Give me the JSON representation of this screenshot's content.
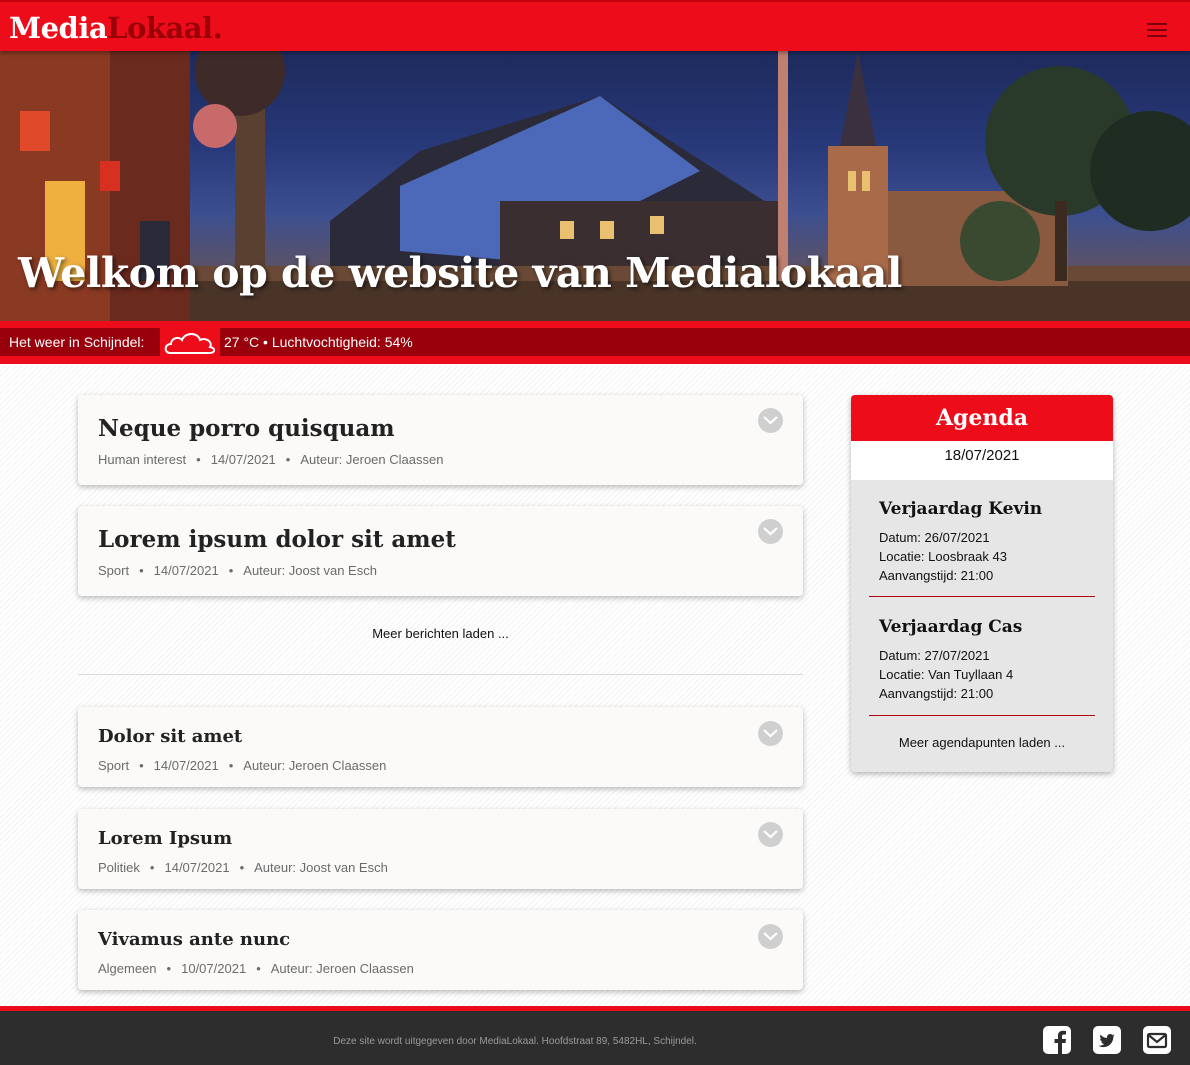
{
  "header": {
    "logo_part1": "Media",
    "logo_part2": "Lokaal.",
    "menu_icon": "hamburger-menu-icon"
  },
  "hero": {
    "title": "Welkom op de website van Medialokaal"
  },
  "weather": {
    "label": "Het weer in Schijndel:",
    "icon": "cloud-icon",
    "info": "27 °C • Luchtvochtigheid: 54%"
  },
  "articles": [
    {
      "title": "Neque porro quisquam",
      "category": "Human interest",
      "date": "14/07/2021",
      "author": "Auteur: Jeroen Claassen"
    },
    {
      "title": "Lorem ipsum dolor sit amet",
      "category": "Sport",
      "date": "14/07/2021",
      "author": "Auteur: Joost van Esch"
    },
    {
      "title": "Dolor sit amet",
      "category": "Sport",
      "date": "14/07/2021",
      "author": "Auteur: Jeroen Claassen"
    },
    {
      "title": "Lorem Ipsum",
      "category": "Politiek",
      "date": "14/07/2021",
      "author": "Auteur: Joost van Esch"
    },
    {
      "title": "Vivamus ante nunc",
      "category": "Algemeen",
      "date": "10/07/2021",
      "author": "Auteur: Jeroen Claassen"
    }
  ],
  "meta_separator": "•",
  "load_more_posts": "Meer berichten laden ...",
  "agenda": {
    "title": "Agenda",
    "date": "18/07/2021",
    "items": [
      {
        "title": "Verjaardag Kevin",
        "datum": "Datum: 26/07/2021",
        "locatie": "Locatie: Loosbraak 43",
        "tijd": "Aanvangstijd: 21:00"
      },
      {
        "title": "Verjaardag Cas",
        "datum": "Datum: 27/07/2021",
        "locatie": "Locatie: Van Tuyllaan 4",
        "tijd": "Aanvangstijd: 21:00"
      }
    ],
    "load_more": "Meer agendapunten laden ..."
  },
  "footer": {
    "text": "Deze site wordt uitgegeven door MediaLokaal. Hoofdstraat 89, 5482HL, Schijndel.",
    "social": [
      "facebook-icon",
      "twitter-icon",
      "mail-icon"
    ]
  },
  "colors": {
    "brand_red": "#ec0c1a",
    "dark_red": "#99000b",
    "footer_bg": "#2d2d2d"
  }
}
